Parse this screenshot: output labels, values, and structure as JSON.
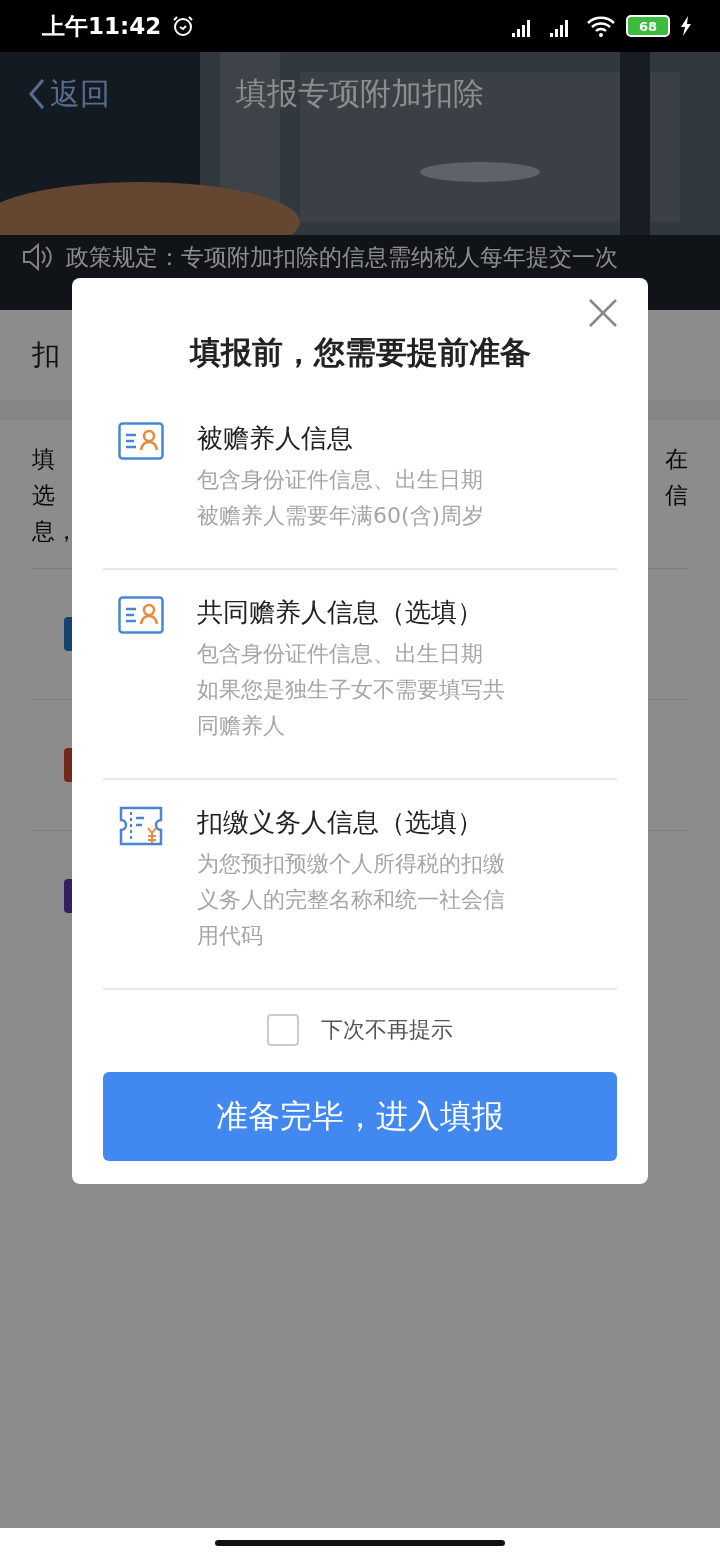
{
  "status_bar": {
    "time": "上午11:42",
    "battery": "68"
  },
  "header": {
    "back": "返回",
    "title": "填报专项附加扣除"
  },
  "notice": {
    "text": "政策规定：专项附加扣除的信息需纳税人每年提交一次"
  },
  "background": {
    "section_title": "扣",
    "body_lines": [
      {
        "left": "填",
        "right": "在"
      },
      {
        "left": "选",
        "right": "信"
      },
      {
        "left": "息，"
      }
    ]
  },
  "dialog": {
    "title": "填报前，您需要提前准备",
    "items": [
      {
        "kind": "person",
        "title": "被赡养人信息",
        "lines": [
          "包含身份证件信息、出生日期",
          "被赡养人需要年满60(含)周岁"
        ]
      },
      {
        "kind": "person",
        "title": "共同赡养人信息（选填）",
        "lines": [
          "包含身份证件信息、出生日期",
          "如果您是独生子女不需要填写共",
          "同赡养人"
        ]
      },
      {
        "kind": "receipt",
        "title": "扣缴义务人信息（选填）",
        "lines": [
          "为您预扣预缴个人所得税的扣缴",
          "义务人的完整名称和统一社会信",
          "用代码"
        ]
      }
    ],
    "dont_remind": {
      "label": "下次不再提示",
      "checked": false
    },
    "button": "准备完毕，进入填报"
  }
}
